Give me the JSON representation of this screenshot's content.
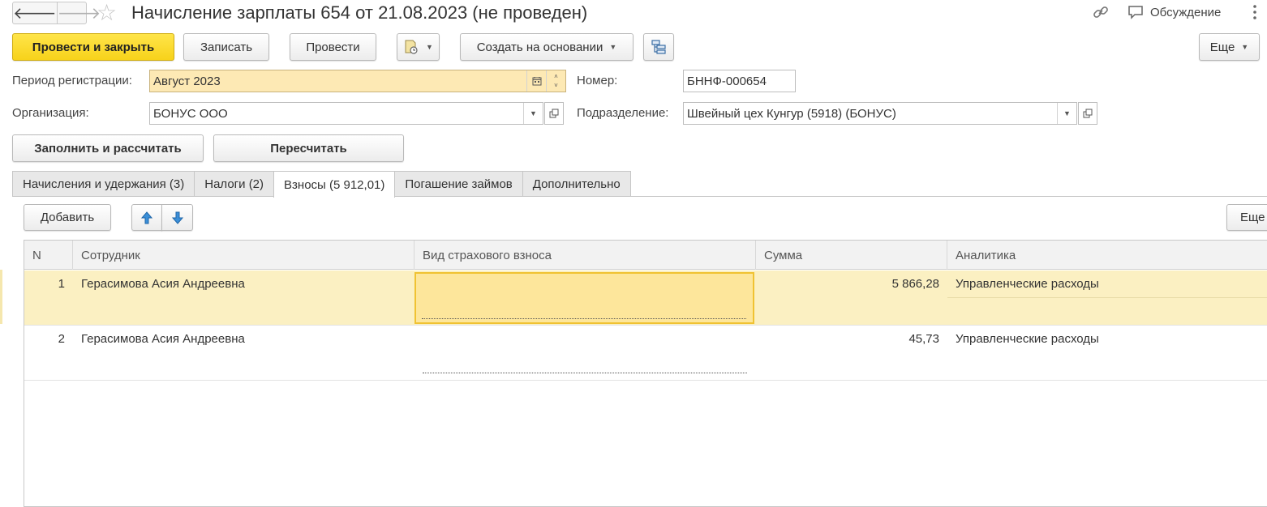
{
  "window": {
    "title": "Начисление зарплаты 654 от 21.08.2023 (не проведен)",
    "discuss_label": "Обсуждение",
    "icons": [
      "arrow-left-icon",
      "arrow-right-icon",
      "star-icon",
      "link-icon",
      "discussion-icon",
      "kebab-icon"
    ]
  },
  "toolbar": {
    "post_close": "Провести и закрыть",
    "save": "Записать",
    "post": "Провести",
    "create_based": "Создать на основании",
    "more": "Еще"
  },
  "form": {
    "period_label": "Период регистрации:",
    "period_value": "Август 2023",
    "number_label": "Номер:",
    "number_value": "БННФ-000654",
    "org_label": "Организация:",
    "org_value": "БОНУС ООО",
    "dept_label": "Подразделение:",
    "dept_value": "Швейный цех Кунгур (5918) (БОНУС)",
    "fill_calc": "Заполнить и рассчитать",
    "recalc": "Пересчитать"
  },
  "tabs": [
    {
      "label": "Начисления и удержания (3)",
      "active": false
    },
    {
      "label": "Налоги (2)",
      "active": false
    },
    {
      "label": "Взносы (5 912,01)",
      "active": true
    },
    {
      "label": "Погашение займов",
      "active": false
    },
    {
      "label": "Дополнительно",
      "active": false
    }
  ],
  "table_toolbar": {
    "add": "Добавить",
    "more": "Еще"
  },
  "table": {
    "columns": [
      "N",
      "Сотрудник",
      "Вид страхового взноса",
      "Сумма",
      "Аналитика"
    ],
    "rows": [
      {
        "n": "1",
        "employee": "Герасимова Асия Андреевна",
        "type": "",
        "sum": "5 866,28",
        "analytics": "Управленческие расходы",
        "selected": true
      },
      {
        "n": "2",
        "employee": "Герасимова Асия Андреевна",
        "type": "",
        "sum": "45,73",
        "analytics": "Управленческие расходы",
        "selected": false
      }
    ]
  },
  "colors": {
    "primary_button": "#f7d21a",
    "selected_row": "#fbf0c2",
    "active_cell": "#fde69b",
    "period_field": "#fde9b4"
  }
}
